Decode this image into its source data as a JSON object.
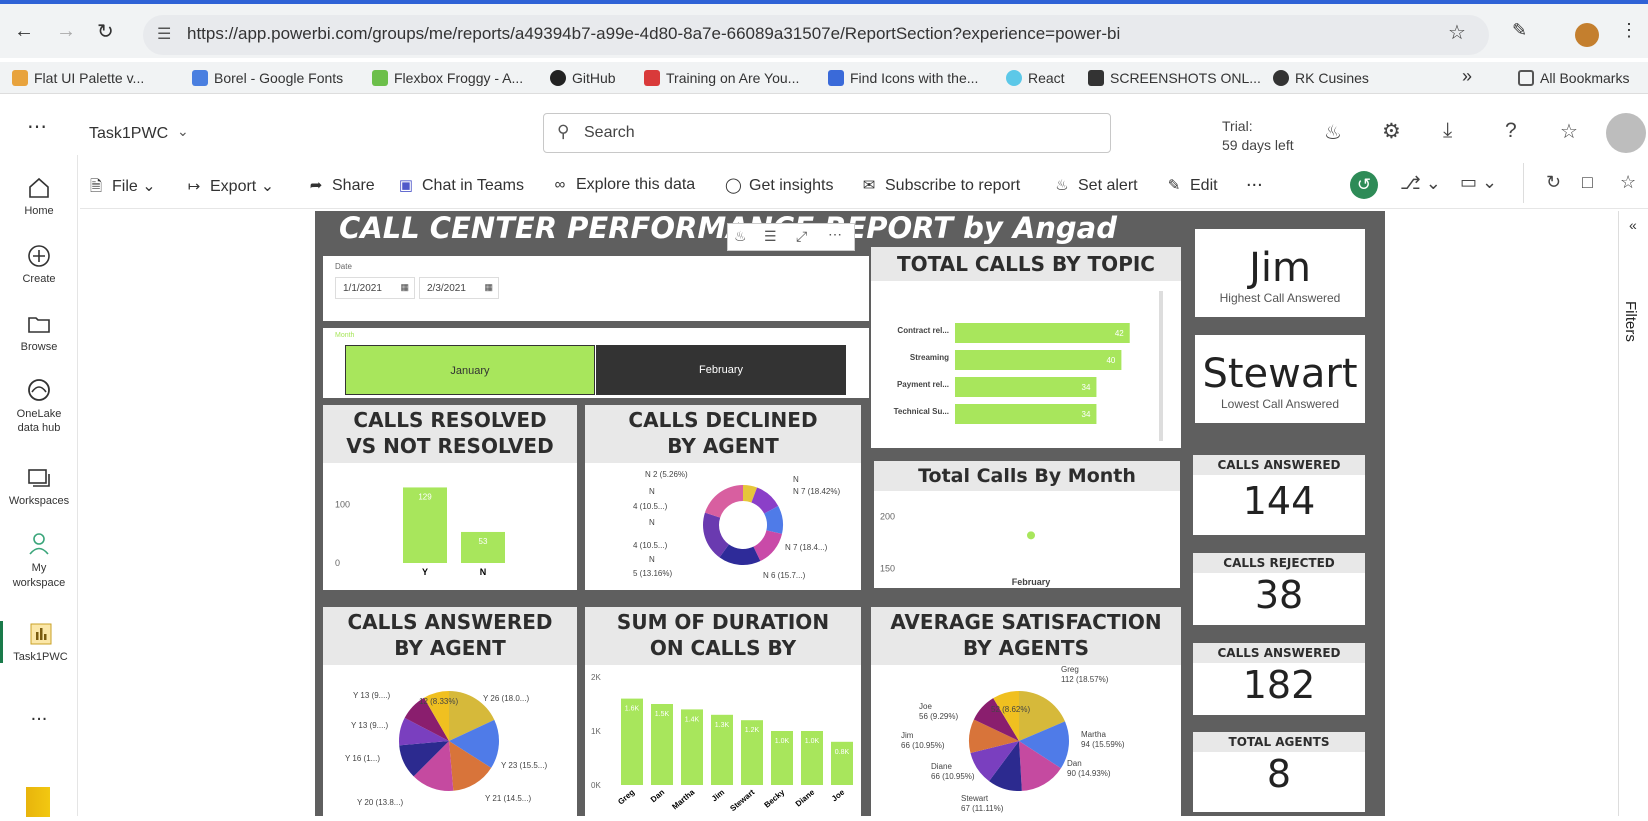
{
  "browser": {
    "url": "https://app.powerbi.com/groups/me/reports/a49394b7-a99e-4d80-8a7e-66089a31507e/ReportSection?experience=power-bi",
    "bookmarks": [
      "Flat UI Palette v...",
      "Borel - Google Fonts",
      "Flexbox Froggy - A...",
      "GitHub",
      "Training on Are You...",
      "Find Icons with the...",
      "React",
      "SCREENSHOTS ONL...",
      "RK Cusines"
    ],
    "all_bookmarks": "All Bookmarks",
    "more": "»"
  },
  "app": {
    "report_name": "Task1PWC",
    "search_placeholder": "Search",
    "trial_line1": "Trial:",
    "trial_line2": "59 days left"
  },
  "sidebar": {
    "items": [
      {
        "label": "Home"
      },
      {
        "label": "Create"
      },
      {
        "label": "Browse"
      },
      {
        "label": "OneLake data hub"
      },
      {
        "label": "Workspaces"
      },
      {
        "label": "My workspace"
      },
      {
        "label": "Task1PWC"
      },
      {
        "label": "..."
      }
    ]
  },
  "toolbar": {
    "file": "File",
    "export": "Export",
    "share": "Share",
    "chat": "Chat in Teams",
    "explore": "Explore this data",
    "insights": "Get insights",
    "subscribe": "Subscribe to report",
    "alert": "Set alert",
    "edit": "Edit",
    "more": "..."
  },
  "filters_label": "Filters",
  "report": {
    "title": "CALL CENTER PERFORMANCE REPORT by Angad",
    "date_label": "Date",
    "date_from": "1/1/2021",
    "date_to": "2/3/2021",
    "month_label": "Month",
    "months": [
      "January",
      "February"
    ],
    "v_resolved": "CALLS RESOLVED VS NOT RESOLVED",
    "v_declined": "CALLS DECLINED BY AGENT",
    "v_topic": "TOTAL CALLS BY TOPIC",
    "v_month": "Total Calls By Month",
    "v_answered_agent": "CALLS ANSWERED BY AGENT",
    "v_duration": "SUM OF DURATION ON CALLS BY AGENTS",
    "v_satisfaction": "AVERAGE SATISFACTION BY AGENTS",
    "highest_name": "Jim",
    "highest_label": "Highest Call Answered",
    "lowest_name": "Stewart",
    "lowest_label": "Lowest Call Answered",
    "kpis": [
      {
        "label": "CALLS ANSWERED",
        "value": "144"
      },
      {
        "label": "CALLS REJECTED",
        "value": "38"
      },
      {
        "label": "CALLS ANSWERED",
        "value": "182"
      },
      {
        "label": "TOTAL AGENTS",
        "value": "8"
      }
    ]
  },
  "colors": {
    "accent": "#a8e65c",
    "dark": "#333333",
    "canvas": "#5f5f5f"
  },
  "chart_data": [
    {
      "type": "bar",
      "title": "CALLS RESOLVED VS NOT RESOLVED",
      "categories": [
        "Y",
        "N"
      ],
      "values": [
        129,
        53
      ],
      "yticks": [
        "0",
        "100"
      ],
      "ylim": [
        0,
        140
      ]
    },
    {
      "type": "pie",
      "title": "CALLS DECLINED BY AGENT",
      "labels": [
        "N 2 (5.26%)",
        "N",
        "4 (10.5...)",
        "N",
        "4 (10.5...)",
        "N",
        "5 (13.16%)",
        "N 6 (15.7...)",
        "N 7 (18.4...)",
        "N 7 (18.42%)"
      ],
      "values": [
        2,
        4,
        4,
        5,
        6,
        7,
        7
      ],
      "donut": true
    },
    {
      "type": "bar",
      "title": "TOTAL CALLS BY TOPIC",
      "orientation": "horizontal",
      "categories": [
        "Contract rel...",
        "Streaming",
        "Payment rel...",
        "Technical Su..."
      ],
      "values": [
        42,
        40,
        34,
        34
      ],
      "xlim": [
        0,
        50
      ]
    },
    {
      "type": "scatter",
      "title": "Total Calls By Month",
      "categories": [
        "February"
      ],
      "values": [
        182
      ],
      "yticks": [
        "150",
        "200"
      ],
      "ylim": [
        140,
        215
      ]
    },
    {
      "type": "pie",
      "title": "CALLS ANSWERED BY AGENT",
      "labels": [
        "Y 13 (9....)",
        "Y 26 (18.0...)",
        "Y 13 (9....)",
        "Y 16 (1...)",
        "Y 23 (15.5...)",
        "Y 20 (13.8...)",
        "Y 21 (14.5...)",
        "12 (8.33%)"
      ],
      "values": [
        26,
        23,
        21,
        20,
        16,
        13,
        13,
        12
      ]
    },
    {
      "type": "bar",
      "title": "SUM OF DURATION ON CALLS BY AGENTS",
      "categories": [
        "Greg",
        "Dan",
        "Martha",
        "Jim",
        "Stewart",
        "Becky",
        "Diane",
        "Joe"
      ],
      "values": [
        1600,
        1500,
        1400,
        1300,
        1200,
        1000,
        1000,
        800
      ],
      "labels": [
        "1.6K",
        "1.5K",
        "1.4K",
        "1.3K",
        "1.2K",
        "1.0K",
        "1.0K",
        "0.8K"
      ],
      "yticks": [
        "0K",
        "1K",
        "2K"
      ],
      "ylim": [
        0,
        2000
      ]
    },
    {
      "type": "pie",
      "title": "AVERAGE SATISFACTION BY AGENTS",
      "labels": [
        "Greg 112 (18.57%)",
        "Martha 94 (15.59%)",
        "Dan 90 (14.93%)",
        "Stewart 67 (11.11%)",
        "Diane 66 (10.95%)",
        "Jim 66 (10.95%)",
        "Joe 56 (9.29%)",
        "52 (8.62%)"
      ],
      "values": [
        112,
        94,
        90,
        67,
        66,
        66,
        56,
        52
      ]
    }
  ]
}
